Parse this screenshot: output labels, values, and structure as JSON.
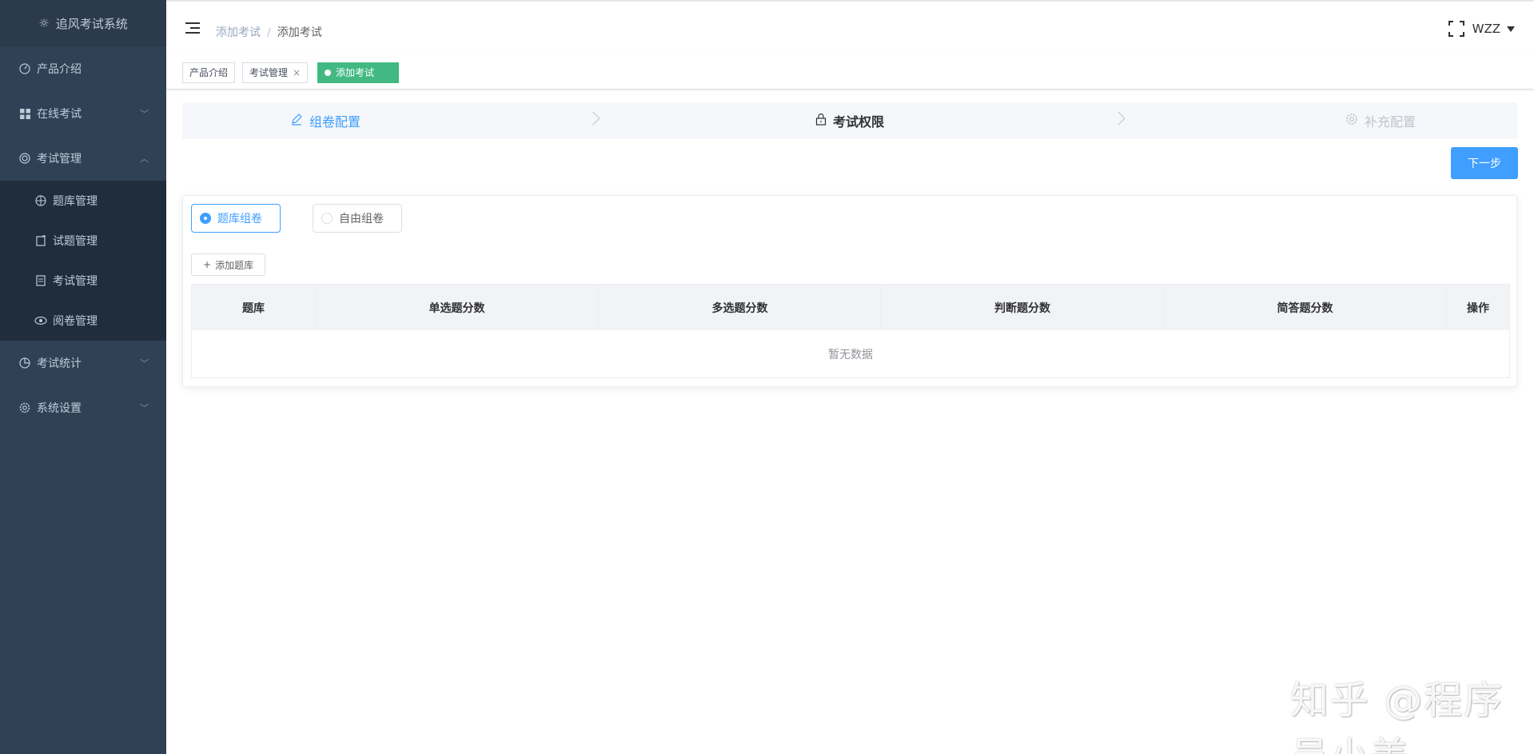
{
  "logo": {
    "title": "追风考试系统",
    "icon": "sun-icon"
  },
  "sidebar": {
    "items": [
      {
        "label": "产品介绍",
        "icon": "dashboard-icon"
      },
      {
        "label": "在线考试",
        "icon": "grid-icon",
        "arrow": "down"
      },
      {
        "label": "考试管理",
        "icon": "lifebuoy-icon",
        "arrow": "up"
      },
      {
        "label": "题库管理",
        "icon": "target-icon"
      },
      {
        "label": "试题管理",
        "icon": "doc-edit-icon"
      },
      {
        "label": "考试管理",
        "icon": "list-doc-icon"
      },
      {
        "label": "阅卷管理",
        "icon": "eye-icon"
      },
      {
        "label": "考试统计",
        "icon": "pie-chart-icon",
        "arrow": "down"
      },
      {
        "label": "系统设置",
        "icon": "gear-icon",
        "arrow": "down"
      }
    ]
  },
  "navbar": {
    "breadcrumb": [
      "添加考试",
      "添加考试"
    ],
    "user": "WZZ"
  },
  "tags": [
    {
      "label": "产品介绍"
    },
    {
      "label": "考试管理",
      "close": "×"
    },
    {
      "label": "添加考试",
      "active": true
    }
  ],
  "steps": [
    {
      "label": "组卷配置",
      "status": "done",
      "icon": "edit-icon"
    },
    {
      "label": "考试权限",
      "status": "current",
      "icon": "lock-icon"
    },
    {
      "label": "补充配置",
      "status": "wait",
      "icon": "gear-icon"
    }
  ],
  "next_button": "下一步",
  "radios": [
    {
      "label": "题库组卷",
      "checked": true
    },
    {
      "label": "自由组卷",
      "checked": false
    }
  ],
  "add_button": "添加题库",
  "table": {
    "headers": [
      "题库",
      "单选题分数",
      "多选题分数",
      "判断题分数",
      "简答题分数",
      "操作"
    ],
    "empty_text": "暂无数据"
  },
  "watermark": "知乎 @程序员小美",
  "colors": {
    "sidebar_bg": "#304156",
    "primary": "#409eff",
    "tag_active": "#42b983"
  }
}
